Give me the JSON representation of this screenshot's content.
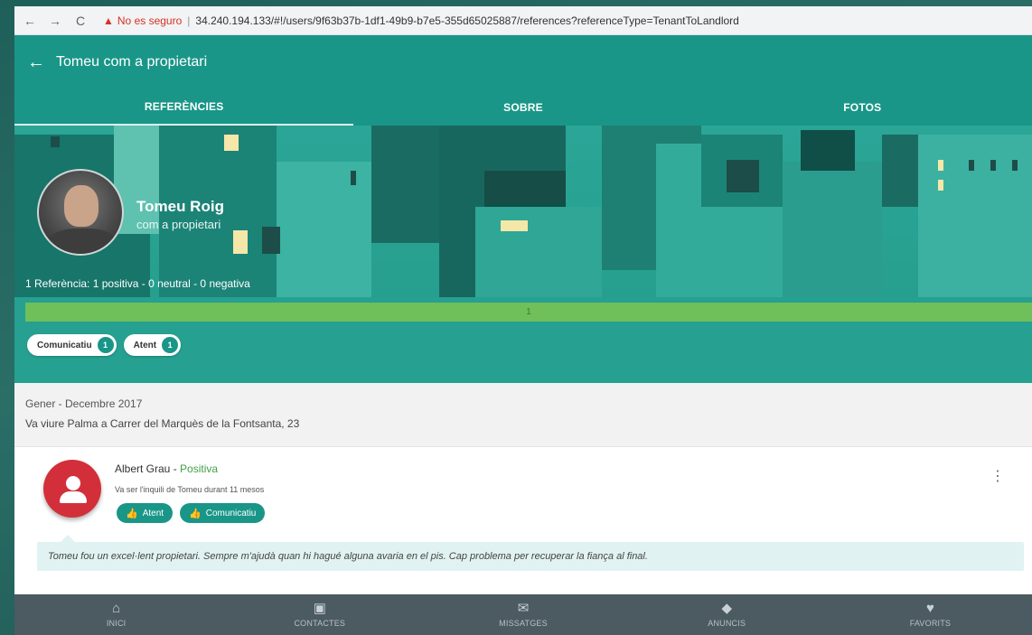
{
  "browser": {
    "insecure_label": "No es seguro",
    "separator": "|",
    "url": "34.240.194.133/#!/users/9f63b37b-1df1-49b9-b7e5-355d65025887/references?referenceType=TenantToLandlord"
  },
  "header": {
    "title": "Tomeu com a propietari"
  },
  "tabs": [
    {
      "label": "REFERÈNCIES",
      "active": true
    },
    {
      "label": "SOBRE",
      "active": false
    },
    {
      "label": "FOTOS",
      "active": false
    }
  ],
  "profile": {
    "name": "Tomeu Roig",
    "role": "com a propietari",
    "stats": "1 Referència: 1 positiva  - 0 neutral  - 0 negativa",
    "bar_value": "1",
    "positive_fraction": 1.0,
    "chips": [
      {
        "label": "Comunicatiu",
        "count": "1"
      },
      {
        "label": "Atent",
        "count": "1"
      }
    ]
  },
  "period": {
    "dates": "Gener - Decembre 2017",
    "address": "Va viure Palma a Carrer del Marquès de la Fontsanta, 23"
  },
  "reference": {
    "author": "Albert Grau",
    "dash": " - ",
    "verdict": "Positiva",
    "subtitle": "Va ser l'inquili de Tomeu durant 11 mesos",
    "tags": [
      "Atent",
      "Comunicatiu"
    ],
    "comment": "Tomeu fou un excel·lent propietari. Sempre m'ajudà quan hi hagué alguna avaria en el pis. Cap problema per recuperar la fiança al final."
  },
  "bottom_nav": [
    {
      "label": "INICI",
      "icon": "home-icon"
    },
    {
      "label": "CONTACTES",
      "icon": "contacts-icon"
    },
    {
      "label": "MISSATGES",
      "icon": "mail-icon"
    },
    {
      "label": "ANUNCIS",
      "icon": "tag-icon"
    },
    {
      "label": "FAVORITS",
      "icon": "heart-icon"
    }
  ],
  "colors": {
    "primary": "#199688",
    "positive": "#43a047",
    "bar": "#6fbf5b",
    "nav_bg": "#4c5a62",
    "avatar_red": "#d32f3a"
  }
}
